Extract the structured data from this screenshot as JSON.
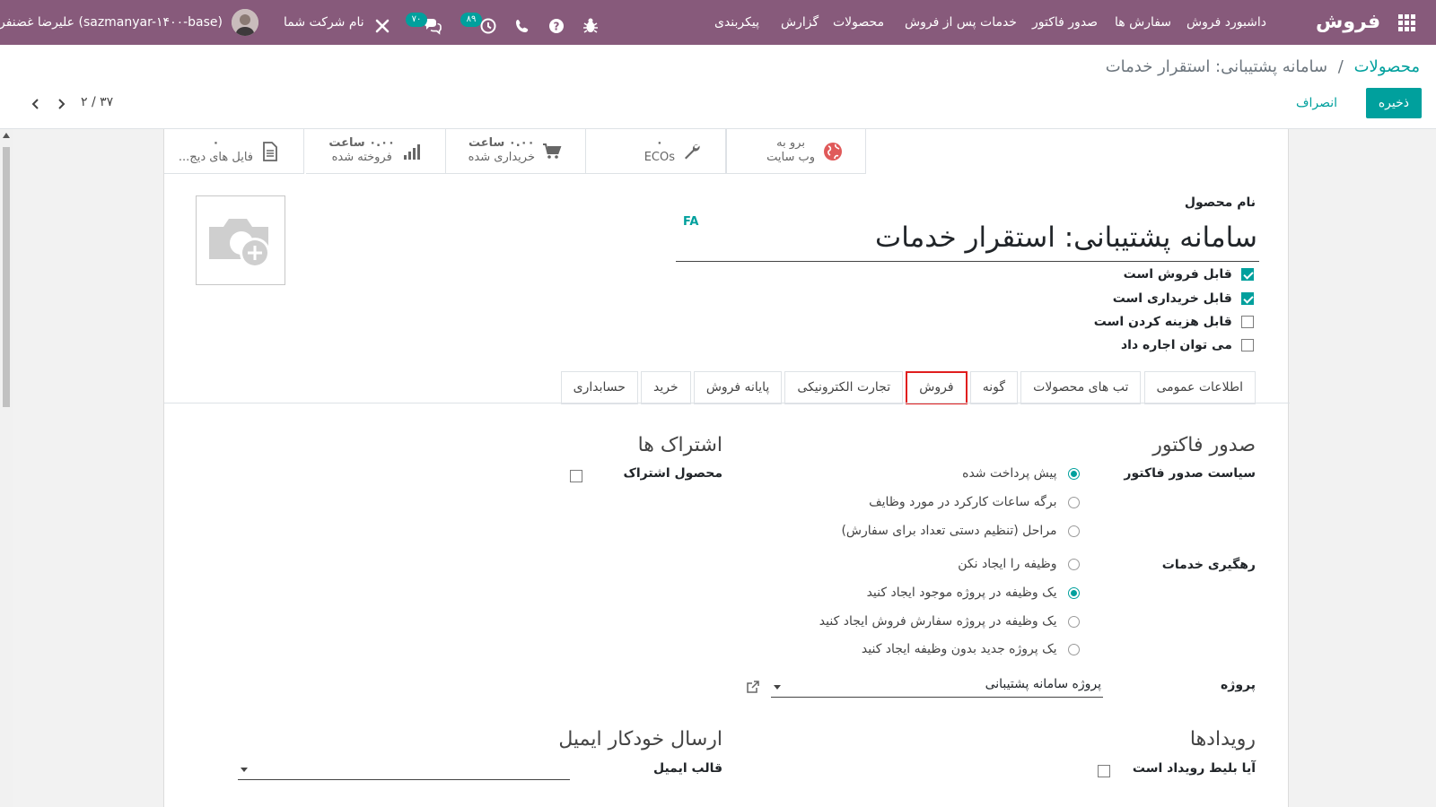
{
  "navbar": {
    "brand": "فروش",
    "menu": [
      {
        "label": "داشبورد فروش"
      },
      {
        "label": "سفارش ها"
      },
      {
        "label": "صدور فاکتور"
      },
      {
        "label": "خدمات پس از فروش"
      },
      {
        "label": "محصولات"
      },
      {
        "label": "گزارش"
      },
      {
        "label": "پیکربندی"
      }
    ],
    "activity_badge": "۸۹",
    "messages_badge": "۷۰",
    "company_switch": "نام شرکت شما",
    "user_name": "علیرضا غضنفری (sazmanyar-۱۴۰۰-base)"
  },
  "breadcrumb": {
    "parent": "محصولات",
    "separator": "/",
    "current": "سامانه پشتیبانی: استقرار خدمات"
  },
  "actions": {
    "save": "ذخیره",
    "discard": "انصراف"
  },
  "pager": {
    "value": "۲ / ۳۷"
  },
  "stat_buttons": [
    {
      "value": "",
      "label": "برو به",
      "label2": "وب سایت"
    },
    {
      "value": "۰",
      "label": "ECOs",
      "label2": ""
    },
    {
      "value": "۰.۰۰ ساعت",
      "label": "خریداری شده",
      "label2": ""
    },
    {
      "value": "۰.۰۰ ساعت",
      "label": "فروخته شده",
      "label2": ""
    },
    {
      "value": "۰",
      "label": "فایل های دیج...",
      "label2": ""
    }
  ],
  "product": {
    "name_label": "نام محصول",
    "name": "سامانه پشتیبانی: استقرار خدمات",
    "lang": "FA",
    "flags": [
      {
        "label": "قابل فروش است",
        "checked": true
      },
      {
        "label": "قابل خریداری است",
        "checked": true
      },
      {
        "label": "قابل هزینه کردن است",
        "checked": false
      },
      {
        "label": "می توان اجاره داد",
        "checked": false
      }
    ]
  },
  "tabs": [
    {
      "label": "اطلاعات عمومی"
    },
    {
      "label": "تب های محصولات"
    },
    {
      "label": "گونه"
    },
    {
      "label": "فروش",
      "active": true
    },
    {
      "label": "تجارت الکترونیکی"
    },
    {
      "label": "پایانه فروش"
    },
    {
      "label": "خرید"
    },
    {
      "label": "حسابداری"
    }
  ],
  "sales_tab": {
    "invoicing_title": "صدور فاکتور",
    "invoice_policy_label": "سیاست صدور فاکتور",
    "invoice_policy_options": [
      {
        "label": "پیش پرداخت شده",
        "selected": true
      },
      {
        "label": "برگه ساعات کارکرد در مورد وظایف",
        "selected": false
      },
      {
        "label": "مراحل (تنظیم دستی تعداد برای سفارش)",
        "selected": false
      }
    ],
    "service_tracking_label": "رهگیری خدمات",
    "service_tracking_options": [
      {
        "label": "وظیفه را ایجاد نکن",
        "selected": false
      },
      {
        "label": "یک وظیفه در پروژه موجود ایجاد کنید",
        "selected": true
      },
      {
        "label": "یک وظیفه در پروژه سفارش فروش ایجاد کنید",
        "selected": false
      },
      {
        "label": "یک پروژه جدید بدون وظیفه ایجاد کنید",
        "selected": false
      }
    ],
    "project_label": "پروژه",
    "project_value": "پروژه سامانه پشتیبانی",
    "subscriptions_title": "اشتراک ها",
    "subscription_product_label": "محصول اشتراک",
    "subscription_product_checked": false,
    "events_title": "رویدادها",
    "event_ticket_label": "آیا بلیط رویداد است",
    "event_ticket_checked": false,
    "auto_email_title": "ارسال خودکار ایمیل",
    "email_template_label": "قالب ایمیل",
    "email_template_value": ""
  },
  "colors": {
    "brand": "#875a7b",
    "accent": "#00a09d",
    "highlight": "#e01e1e"
  }
}
